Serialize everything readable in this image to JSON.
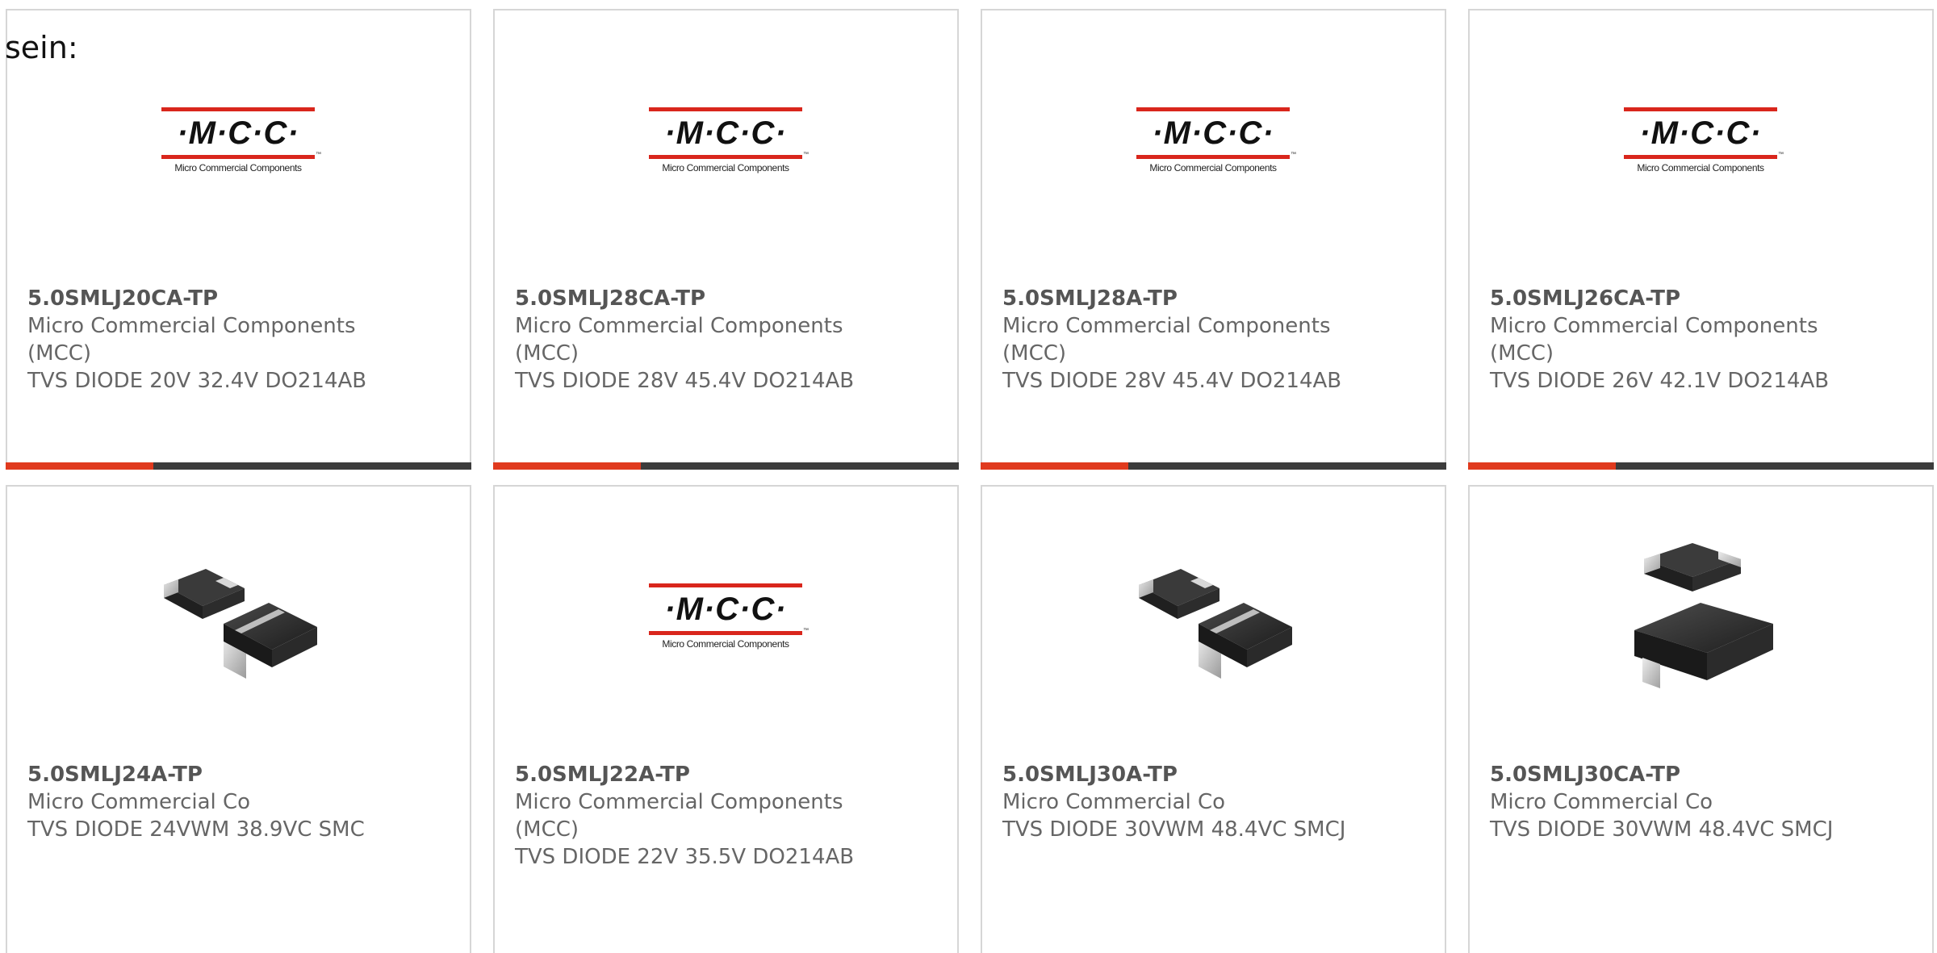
{
  "intro_text": "sein:",
  "colors": {
    "accent": "#e03a1e",
    "bar": "#3c3c3c",
    "logo_red": "#d9261c"
  },
  "logo": {
    "letters": "·M·C·C·",
    "tm": "™",
    "subtitle": "Micro Commercial Components"
  },
  "products": [
    {
      "part_number": "5.0SMLJ20CA-TP",
      "manufacturer": [
        "Micro Commercial Components",
        "(MCC)"
      ],
      "description": "TVS DIODE 20V 32.4V DO214AB",
      "image": "mcc-logo"
    },
    {
      "part_number": "5.0SMLJ28CA-TP",
      "manufacturer": [
        "Micro Commercial Components",
        "(MCC)"
      ],
      "description": "TVS DIODE 28V 45.4V DO214AB",
      "image": "mcc-logo"
    },
    {
      "part_number": "5.0SMLJ28A-TP",
      "manufacturer": [
        "Micro Commercial Components",
        "(MCC)"
      ],
      "description": "TVS DIODE 28V 45.4V DO214AB",
      "image": "mcc-logo"
    },
    {
      "part_number": "5.0SMLJ26CA-TP",
      "manufacturer": [
        "Micro Commercial Components",
        "(MCC)"
      ],
      "description": "TVS DIODE 26V 42.1V DO214AB",
      "image": "mcc-logo"
    },
    {
      "part_number": "5.0SMLJ24A-TP",
      "manufacturer": [
        "Micro Commercial Co"
      ],
      "description": "TVS DIODE 24VWM 38.9VC SMC",
      "image": "smc-package-pair-icon"
    },
    {
      "part_number": "5.0SMLJ22A-TP",
      "manufacturer": [
        "Micro Commercial Components",
        "(MCC)"
      ],
      "description": "TVS DIODE 22V 35.5V DO214AB",
      "image": "mcc-logo"
    },
    {
      "part_number": "5.0SMLJ30A-TP",
      "manufacturer": [
        "Micro Commercial Co"
      ],
      "description": "TVS DIODE 30VWM 48.4VC SMCJ",
      "image": "smc-package-pair-icon"
    },
    {
      "part_number": "5.0SMLJ30CA-TP",
      "manufacturer": [
        "Micro Commercial Co"
      ],
      "description": "TVS DIODE 30VWM 48.4VC SMCJ",
      "image": "smc-package-stack-icon"
    }
  ]
}
